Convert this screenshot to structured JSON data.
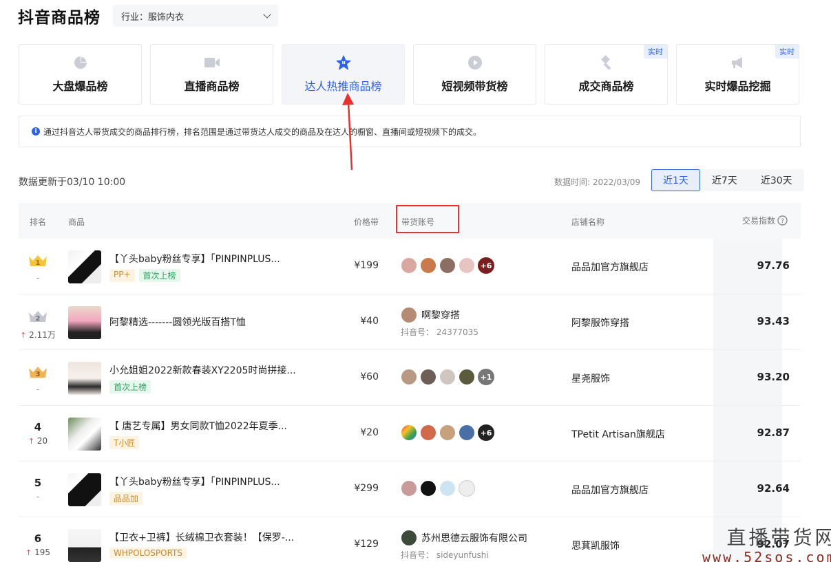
{
  "header": {
    "title": "抖音商品榜",
    "industry_select": "行业：服饰内衣"
  },
  "cards": [
    {
      "label": "大盘爆品榜",
      "icon": "pie-chart-icon",
      "badge": ""
    },
    {
      "label": "直播商品榜",
      "icon": "video-camera-icon",
      "badge": ""
    },
    {
      "label": "达人热推商品榜",
      "icon": "star-badge-icon",
      "badge": "",
      "active": true
    },
    {
      "label": "短视频带货榜",
      "icon": "play-circle-icon",
      "badge": ""
    },
    {
      "label": "成交商品榜",
      "icon": "gavel-icon",
      "badge": "实时"
    },
    {
      "label": "实时爆品挖掘",
      "icon": "megaphone-icon",
      "badge": "实时"
    }
  ],
  "info": {
    "text": "通过抖音达人带货成交的商品排行榜，排名范围是通过带货达人成交的商品及在达人的橱窗、直播间或短视频下的成交。"
  },
  "toolbar": {
    "update_text": "数据更新于03/10 10:00",
    "data_time": "数据时间:  2022/03/09",
    "ranges": [
      "近1天",
      "近7天",
      "近30天"
    ],
    "active_range": "近1天"
  },
  "table": {
    "headers": {
      "rank": "排名",
      "product": "商品",
      "price": "价格带",
      "account": "带货账号",
      "shop": "店铺名称",
      "index": "交易指数"
    },
    "rows": [
      {
        "rank": "1",
        "change": "-",
        "title": "【丫头baby粉丝专享】「PINPINPLUS...",
        "tags": [
          {
            "t": "PP+",
            "k": "brand"
          },
          {
            "t": "首次上榜",
            "k": "new"
          }
        ],
        "price": "¥199",
        "avatars": 4,
        "more": "+6",
        "shop": "品品加官方旗舰店",
        "score": "97.76"
      },
      {
        "rank": "2",
        "change": "2.11万",
        "title": "阿黎精选-------圆领光版百搭T恤",
        "tags": [],
        "price": "¥40",
        "account_name": "啊黎穿搭",
        "account_id": "抖音号：  24377035",
        "shop": "阿黎服饰穿搭",
        "score": "93.43"
      },
      {
        "rank": "3",
        "change": "-",
        "title": "小允姐姐2022新款春装XY2205时尚拼接...",
        "tags": [
          {
            "t": "首次上榜",
            "k": "new"
          }
        ],
        "price": "¥60",
        "avatars": 4,
        "more": "+1",
        "shop": "星尧服饰",
        "score": "93.20"
      },
      {
        "rank": "4",
        "change": "20",
        "title": "【 唐艺专属】男女同款T恤2022年夏季...",
        "tags": [
          {
            "t": "T小匠",
            "k": "brand"
          }
        ],
        "price": "¥20",
        "avatars": 4,
        "more": "+6",
        "shop": "TPetit Artisan旗舰店",
        "score": "92.87"
      },
      {
        "rank": "5",
        "change": "-",
        "title": "【丫头baby粉丝专享】「PINPINPLUS...",
        "tags": [
          {
            "t": "品品加",
            "k": "brand"
          }
        ],
        "price": "¥299",
        "avatars": 4,
        "more": "",
        "shop": "品品加官方旗舰店",
        "score": "92.64"
      },
      {
        "rank": "6",
        "change": "195",
        "title": "【卫衣+卫裤】长绒棉卫衣套装！【保罗-...",
        "tags": [
          {
            "t": "WHPOLOSPORTS",
            "k": "brand"
          }
        ],
        "price": "¥129",
        "account_name": "苏州思德云服饰有限公司",
        "account_id": "抖音号：  sideyunfushi",
        "shop": "思萁凯服饰",
        "score": "92.07"
      }
    ]
  },
  "watermark": {
    "line1": "直播带货网",
    "line2": "www.52sos.com"
  },
  "colors": {
    "accent": "#2e62e8",
    "annotation_red": "#e8332c"
  }
}
